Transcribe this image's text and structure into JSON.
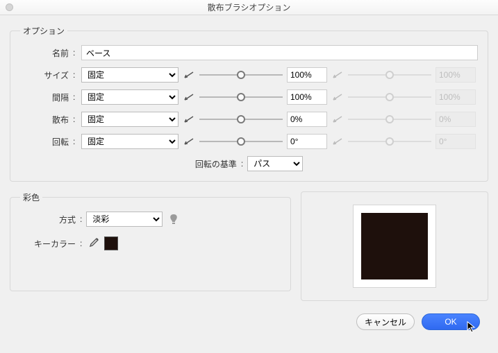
{
  "title": "散布ブラシオプション",
  "options": {
    "legend": "オプション",
    "name_label": "名前",
    "name_value": "ベース",
    "rows": {
      "size": {
        "label": "サイズ",
        "mode": "固定",
        "v1": "100%",
        "v2": "100%",
        "pos1": 50,
        "pos2": 50
      },
      "spacing": {
        "label": "間隔",
        "mode": "固定",
        "v1": "100%",
        "v2": "100%",
        "pos1": 50,
        "pos2": 50
      },
      "scatter": {
        "label": "散布",
        "mode": "固定",
        "v1": "0%",
        "v2": "0%",
        "pos1": 50,
        "pos2": 50
      },
      "rotation": {
        "label": "回転",
        "mode": "固定",
        "v1": "0°",
        "v2": "0°",
        "pos1": 50,
        "pos2": 50
      }
    },
    "rotation_base_label": "回転の基準",
    "rotation_base_value": "パス"
  },
  "coloring": {
    "legend": "彩色",
    "method_label": "方式",
    "method_value": "淡彩",
    "keycolor_label": "キーカラー",
    "keycolor": "#1e100c"
  },
  "preview_color": "#1e100c",
  "buttons": {
    "cancel": "キャンセル",
    "ok": "OK"
  }
}
